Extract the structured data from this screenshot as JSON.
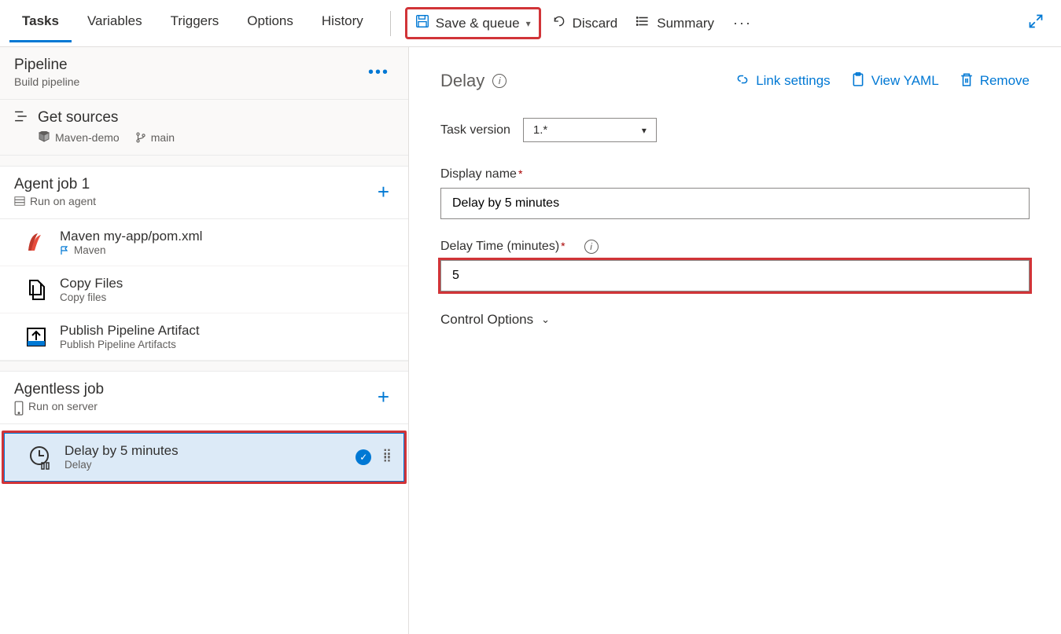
{
  "tabs": {
    "items": [
      {
        "label": "Tasks",
        "active": true
      },
      {
        "label": "Variables",
        "active": false
      },
      {
        "label": "Triggers",
        "active": false
      },
      {
        "label": "Options",
        "active": false
      },
      {
        "label": "History",
        "active": false
      }
    ]
  },
  "toolbar": {
    "save_queue": "Save & queue",
    "discard": "Discard",
    "summary": "Summary"
  },
  "left": {
    "pipeline": {
      "title": "Pipeline",
      "sub": "Build pipeline"
    },
    "get_sources": {
      "title": "Get sources",
      "repo": "Maven-demo",
      "branch": "main"
    },
    "agent_job": {
      "title": "Agent job 1",
      "sub": "Run on agent"
    },
    "tasks": [
      {
        "title": "Maven my-app/pom.xml",
        "sub": "Maven"
      },
      {
        "title": "Copy Files",
        "sub": "Copy files"
      },
      {
        "title": "Publish Pipeline Artifact",
        "sub": "Publish Pipeline Artifacts"
      }
    ],
    "agentless_job": {
      "title": "Agentless job",
      "sub": "Run on server"
    },
    "delay_task": {
      "title": "Delay by 5 minutes",
      "sub": "Delay"
    }
  },
  "right": {
    "title": "Delay",
    "links": {
      "link_settings": "Link settings",
      "view_yaml": "View YAML",
      "remove": "Remove"
    },
    "task_version_label": "Task version",
    "task_version_value": "1.*",
    "display_name_label": "Display name",
    "display_name_value": "Delay by 5 minutes",
    "delay_time_label": "Delay Time (minutes)",
    "delay_time_value": "5",
    "control_options": "Control Options"
  }
}
